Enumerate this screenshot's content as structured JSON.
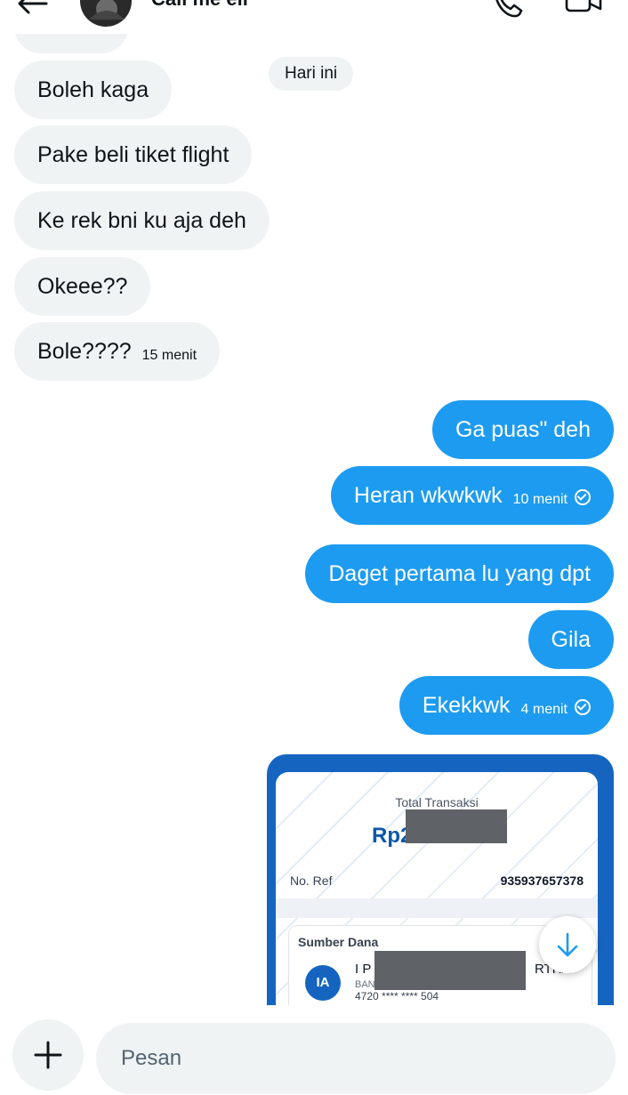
{
  "header": {
    "contact_name": "Call me eli",
    "icons": [
      "back-arrow-icon",
      "avatar",
      "phone-icon",
      "video-icon"
    ]
  },
  "date_separator": "Hari ini",
  "messages": [
    {
      "side": "in",
      "text": "Boleh kaga",
      "time": ""
    },
    {
      "side": "in",
      "text": "Pake beli tiket flight",
      "time": ""
    },
    {
      "side": "in",
      "text": "Ke rek bni ku aja deh",
      "time": ""
    },
    {
      "side": "in",
      "text": "Okeee??",
      "time": ""
    },
    {
      "side": "in",
      "text": "Bole????",
      "time": "15 menit"
    },
    {
      "side": "out",
      "text": "Ga puas\" deh",
      "time": ""
    },
    {
      "side": "out",
      "text": "Heran wkwkwk",
      "time": "10 menit"
    },
    {
      "side": "out",
      "text": "Daget pertama lu yang dpt",
      "time": ""
    },
    {
      "side": "out",
      "text": "Gila",
      "time": ""
    },
    {
      "side": "out",
      "text": "Ekekkwk",
      "time": "4 menit"
    }
  ],
  "receipt": {
    "total_label": "Total Transaksi",
    "amount": "Rp2.",
    "ref_label": "No. Ref",
    "ref_value": "935937657378",
    "source_label": "Sumber Dana",
    "initials": "IA",
    "account_name_start": "I P",
    "account_name_end": "RTHA",
    "bank_prefix": "BAN",
    "account_number": "4720 **** **** 504",
    "accent_color": "#1565c0"
  },
  "composer": {
    "placeholder": "Pesan"
  }
}
